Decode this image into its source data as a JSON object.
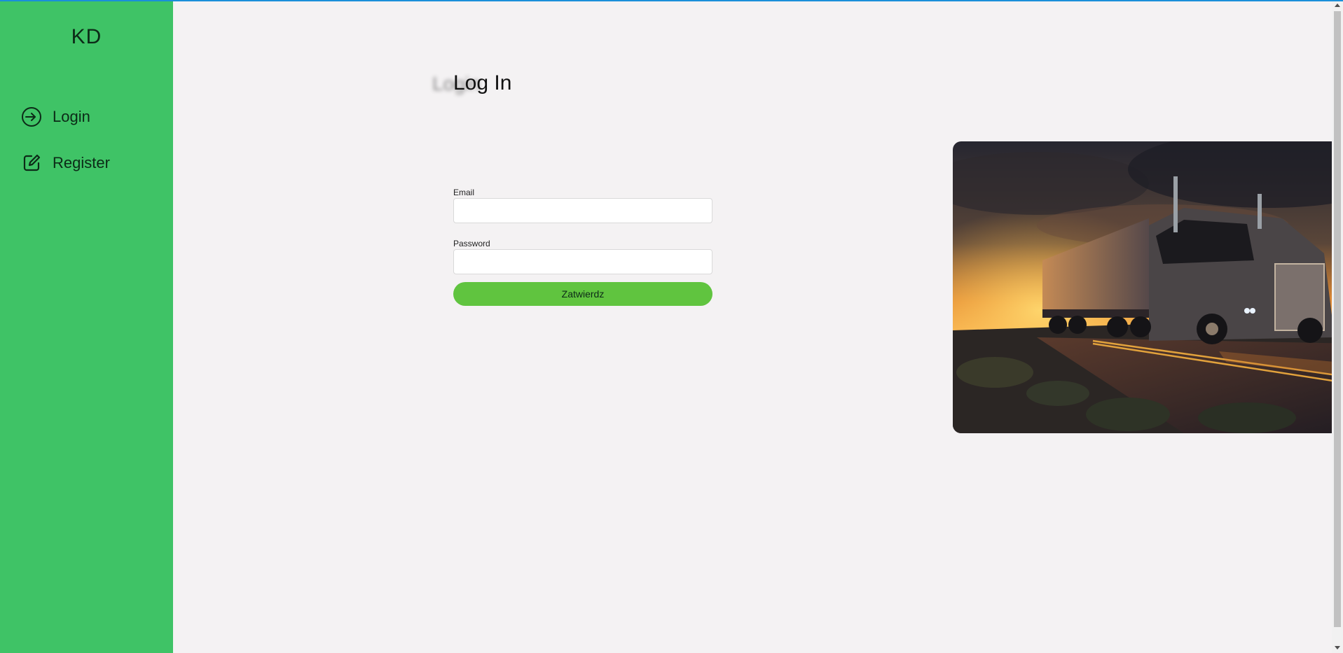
{
  "sidebar": {
    "brand": "KD",
    "items": [
      {
        "label": "Login",
        "icon": "login-arrow-icon"
      },
      {
        "label": "Register",
        "icon": "edit-icon"
      }
    ]
  },
  "main": {
    "title_ghost": "Login",
    "title": "Log In",
    "form": {
      "email_label": "Email",
      "email_value": "",
      "password_label": "Password",
      "password_value": "",
      "submit_label": "Zatwierdz"
    },
    "image": {
      "alt": "Truck on road at sunset"
    }
  },
  "colors": {
    "sidebar_bg": "#3fc366",
    "button_bg": "#60c43f",
    "page_bg": "#f4f2f3",
    "top_accent": "#1a8fd9"
  }
}
